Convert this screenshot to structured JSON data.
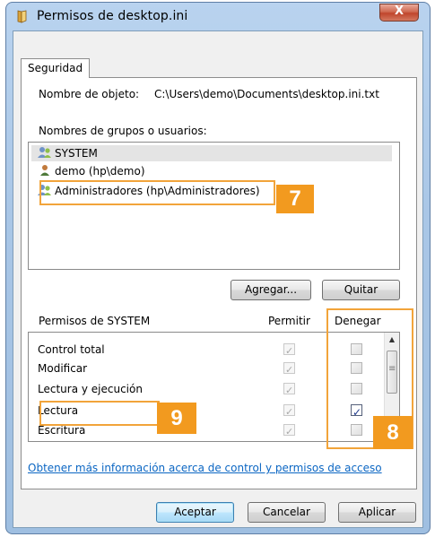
{
  "window": {
    "title": "Permisos de desktop.ini",
    "close_glyph": "X"
  },
  "tab": {
    "label": "Seguridad"
  },
  "object": {
    "label": "Nombre de objeto:",
    "value": "C:\\Users\\demo\\Documents\\desktop.ini.txt"
  },
  "groups": {
    "label": "Nombres de grupos o usuarios:",
    "items": [
      {
        "name": "SYSTEM",
        "icon": "users-group-icon"
      },
      {
        "name": "demo (hp\\demo)",
        "icon": "user-icon"
      },
      {
        "name": "Administradores (hp\\Administradores)",
        "icon": "users-group-icon"
      }
    ]
  },
  "buttons": {
    "add": "Agregar...",
    "remove": "Quitar",
    "ok": "Aceptar",
    "cancel": "Cancelar",
    "apply": "Aplicar"
  },
  "permissions": {
    "label": "Permisos de SYSTEM",
    "col_allow": "Permitir",
    "col_deny": "Denegar",
    "rows": [
      {
        "name": "Control total",
        "allow": true,
        "deny": false
      },
      {
        "name": "Modificar",
        "allow": true,
        "deny": false
      },
      {
        "name": "Lectura y ejecución",
        "allow": true,
        "deny": false
      },
      {
        "name": "Lectura",
        "allow": true,
        "deny": true
      },
      {
        "name": "Escritura",
        "allow": true,
        "deny": false
      }
    ]
  },
  "link": {
    "text": "Obtener más información acerca de control y permisos de acceso"
  },
  "callouts": {
    "seven": "7",
    "eight": "8",
    "nine": "9"
  },
  "colors": {
    "callout": "#f29a1f",
    "link": "#0b66c3"
  }
}
